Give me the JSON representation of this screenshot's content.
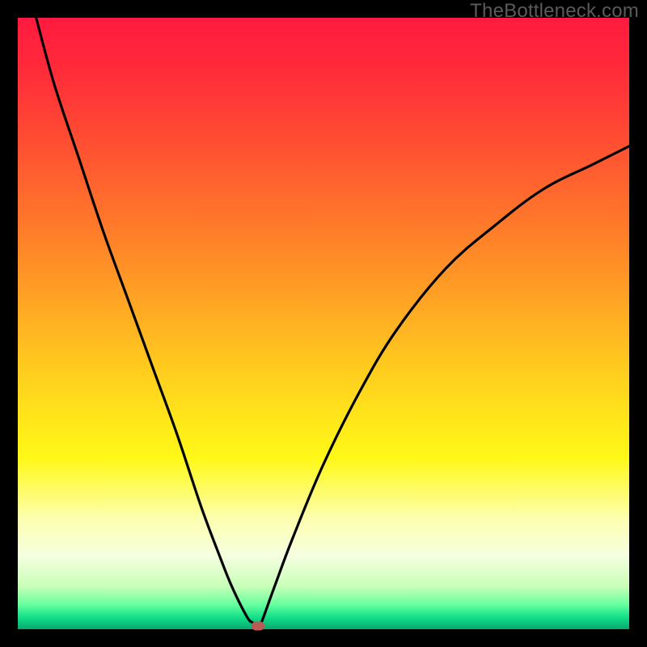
{
  "watermark": "TheBottleneck.com",
  "chart_data": {
    "type": "line",
    "title": "",
    "xlabel": "",
    "ylabel": "",
    "xlim": [
      0,
      100
    ],
    "ylim": [
      0,
      100
    ],
    "series": [
      {
        "name": "curve",
        "x": [
          3,
          6,
          10,
          14,
          18,
          22,
          26,
          30,
          33,
          35,
          37.5,
          38.5,
          39.3,
          40,
          42,
          45,
          50,
          56,
          62,
          70,
          78,
          86,
          94,
          100
        ],
        "y": [
          100,
          89,
          77,
          65,
          54,
          43,
          32,
          20,
          12,
          7,
          2,
          1,
          0,
          1.5,
          7,
          15,
          27,
          39,
          49,
          59,
          66,
          72,
          76,
          79
        ]
      }
    ],
    "marker": {
      "x": 39.3,
      "y": 0.5
    },
    "gradient_description": "vertical red-to-green (bottleneck heat scale)"
  }
}
